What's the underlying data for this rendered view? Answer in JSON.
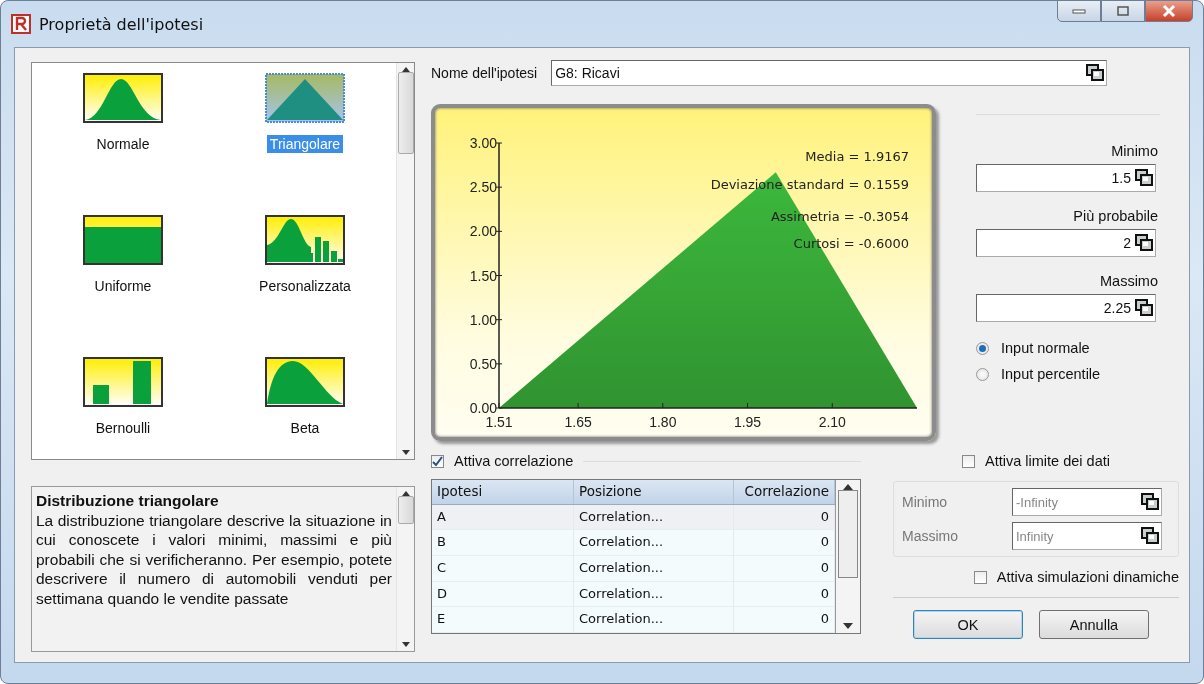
{
  "window": {
    "title": "Proprietà dell'ipotesi"
  },
  "distributions": [
    {
      "kind": "normal",
      "label": "Normale",
      "selected": false
    },
    {
      "kind": "triangular",
      "label": "Triangolare",
      "selected": true
    },
    {
      "kind": "uniform",
      "label": "Uniforme",
      "selected": false
    },
    {
      "kind": "custom",
      "label": "Personalizzata",
      "selected": false
    },
    {
      "kind": "bernoulli",
      "label": "Bernoulli",
      "selected": false
    },
    {
      "kind": "beta",
      "label": "Beta",
      "selected": false
    }
  ],
  "description": {
    "title": "Distribuzione triangolare",
    "text": "La distribuzione triangolare descrive la situazione in cui conoscete i valori minimi, massimi e più probabili che si verificheranno. Per esempio, potete descrivere il numero di automobili venduti per settimana quando le vendite passate"
  },
  "assumption_name": {
    "label": "Nome dell'ipotesi",
    "value": "G8: Ricavi"
  },
  "chart": {
    "chart_data": {
      "type": "area",
      "x": [
        1.51,
        2.0,
        2.25
      ],
      "series": [
        {
          "color": "#3cb83c",
          "values": [
            0,
            2.67,
            0
          ]
        }
      ],
      "xlim": [
        1.51,
        2.25
      ],
      "ylim": [
        0,
        3
      ],
      "xticks": [
        {
          "value": 1.51,
          "label": "1.51"
        },
        {
          "value": 1.65,
          "label": "1.65"
        },
        {
          "value": 1.8,
          "label": "1.80"
        },
        {
          "value": 1.95,
          "label": "1.95"
        },
        {
          "value": 2.1,
          "label": "2.10"
        }
      ],
      "yticks": [
        {
          "value": 0,
          "label": "0.00"
        },
        {
          "value": 0.5,
          "label": "0.50"
        },
        {
          "value": 1,
          "label": "1.00"
        },
        {
          "value": 1.5,
          "label": "1.50"
        },
        {
          "value": 2,
          "label": "2.00"
        },
        {
          "value": 2.5,
          "label": "2.50"
        },
        {
          "value": 3,
          "label": "3.00"
        }
      ],
      "annotations": [
        "Media = 1.9167",
        "Deviazione standard = 0.1559",
        "Assimetria = -0.3054",
        "Curtosi = -0.6000"
      ]
    }
  },
  "parameters": [
    {
      "label": "Minimo",
      "value": "1.5"
    },
    {
      "label": "Più probabile",
      "value": "2"
    },
    {
      "label": "Massimo",
      "value": "2.25"
    }
  ],
  "input_modes": [
    {
      "label": "Input normale",
      "selected": true
    },
    {
      "label": "Input percentile",
      "selected": false
    }
  ],
  "correlation": {
    "label": "Attiva correlazione",
    "checked": true,
    "columns": [
      "Ipotesi",
      "Posizione",
      "Correlazione"
    ],
    "rows": [
      [
        "A",
        "Correlation...",
        "0"
      ],
      [
        "B",
        "Correlation...",
        "0"
      ],
      [
        "C",
        "Correlation...",
        "0"
      ],
      [
        "D",
        "Correlation...",
        "0"
      ],
      [
        "E",
        "Correlation...",
        "0"
      ]
    ]
  },
  "data_limits": {
    "label": "Attiva limite dei dati",
    "checked": false,
    "fields": [
      {
        "label": "Minimo",
        "value": "-Infinity"
      },
      {
        "label": "Massimo",
        "value": "Infinity"
      }
    ]
  },
  "dynamic_simulation": {
    "label": "Attiva simulazioni dinamiche",
    "checked": false
  },
  "buttons": [
    {
      "label": "OK",
      "default": true
    },
    {
      "label": "Annulla",
      "default": false
    }
  ]
}
